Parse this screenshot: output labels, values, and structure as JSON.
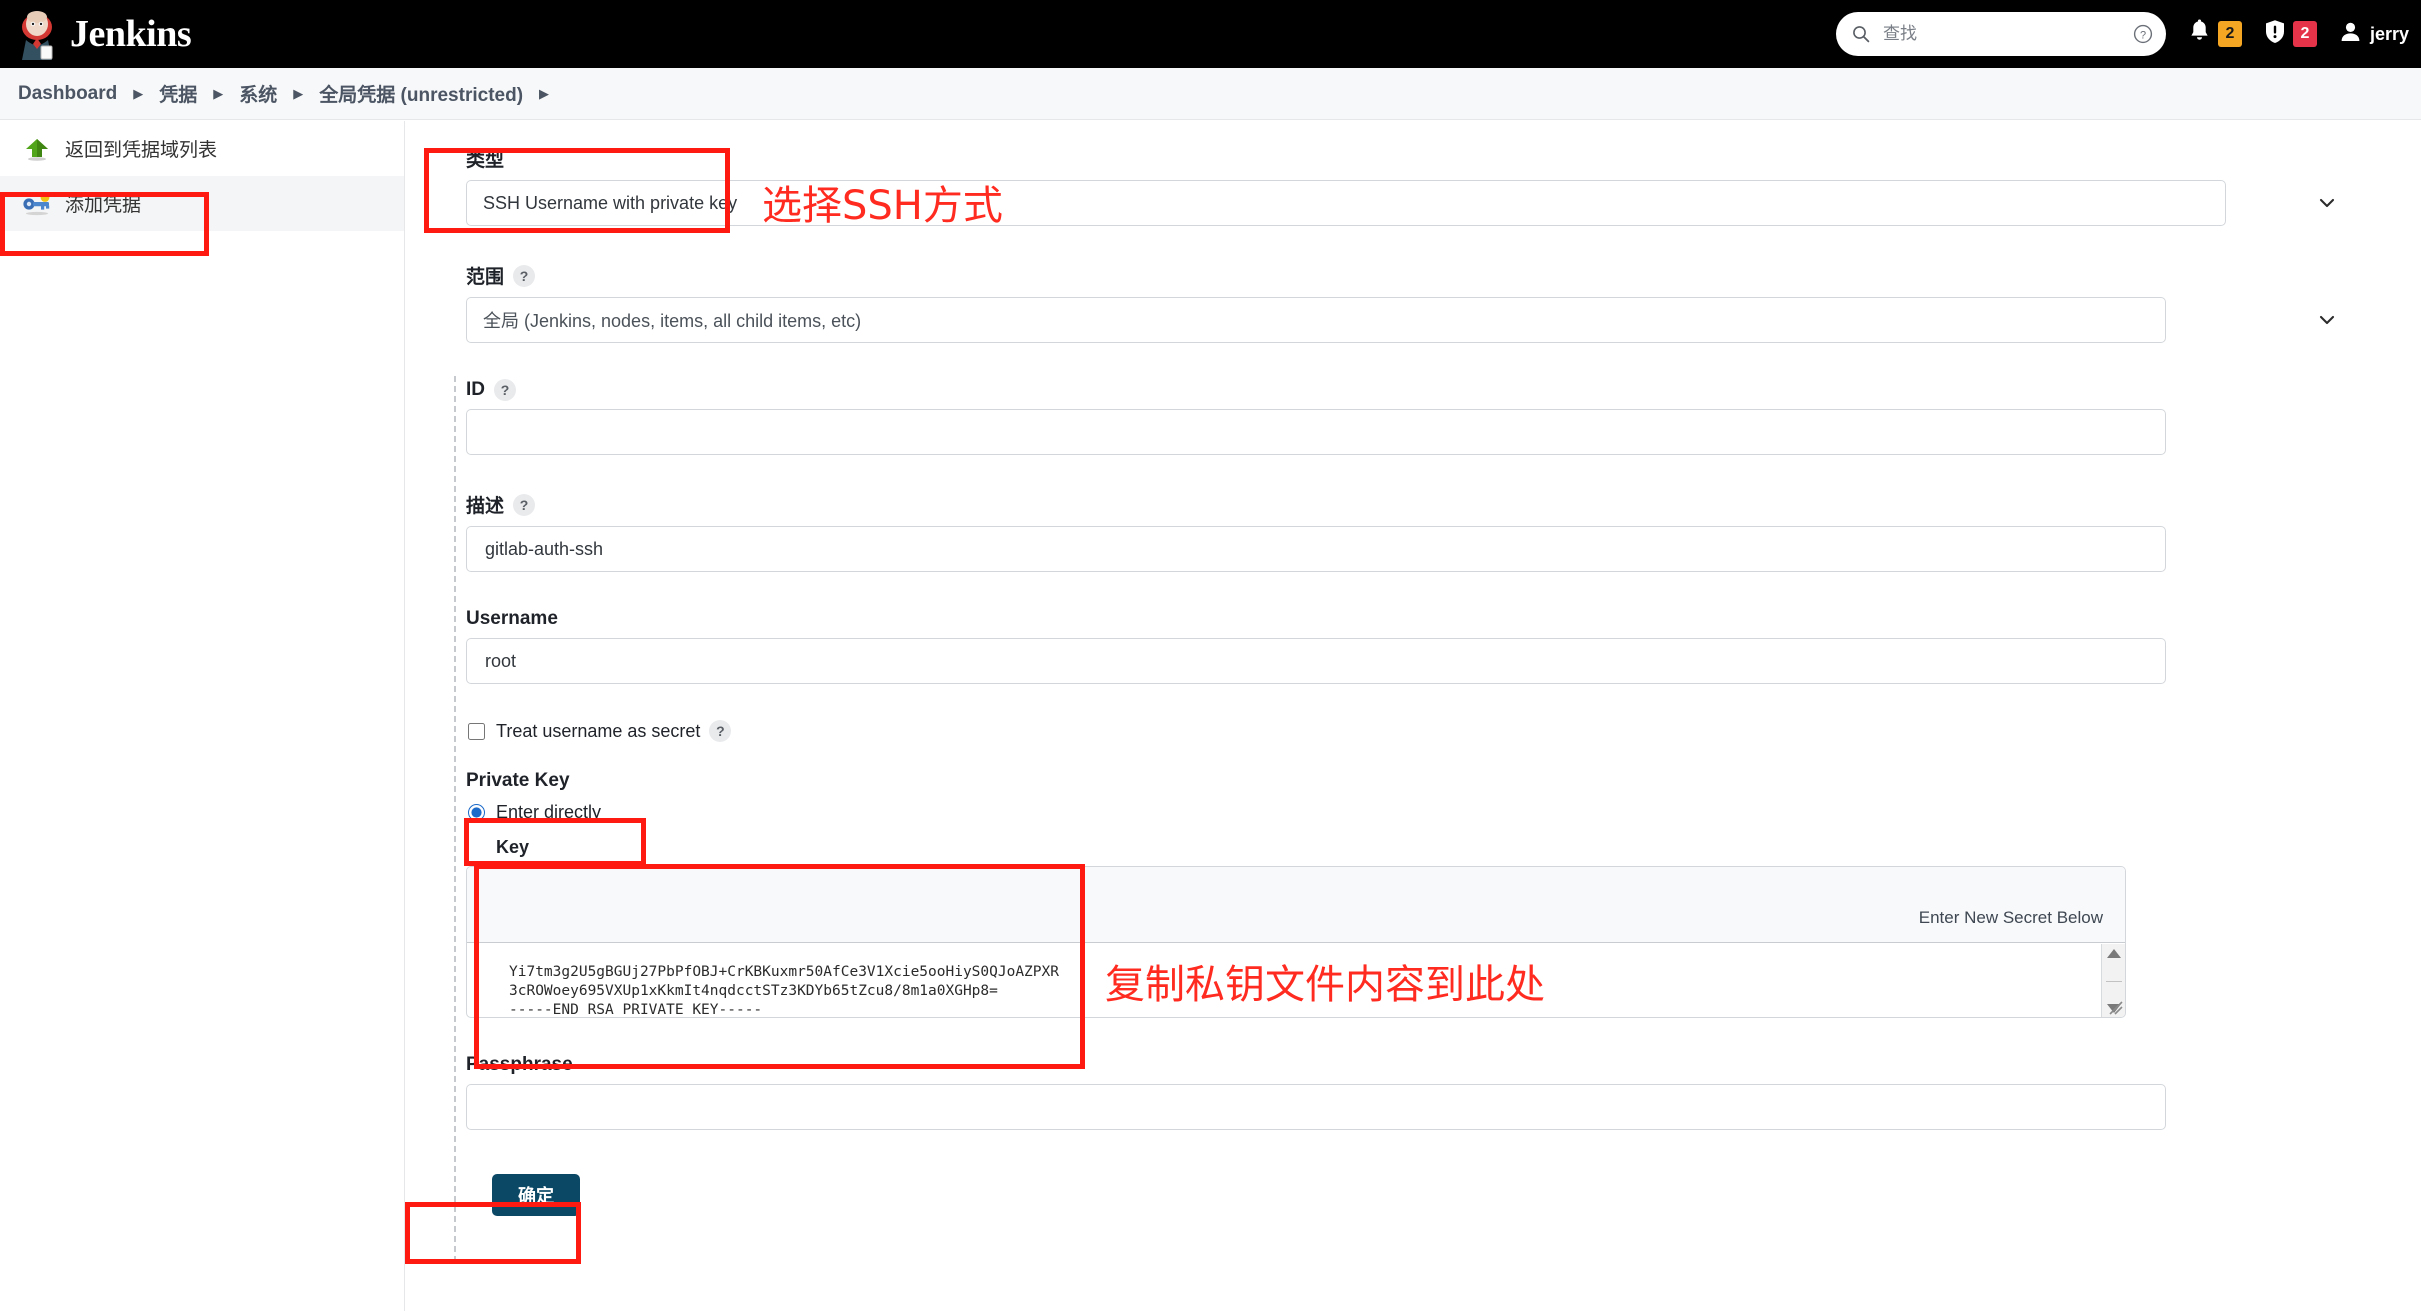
{
  "header": {
    "brand": "Jenkins",
    "search": {
      "placeholder": "查找",
      "value": ""
    },
    "icons": {
      "search": "search-icon",
      "help": "help-circle-icon",
      "bell": "bell-icon",
      "security": "security-shield-icon",
      "user": "user-avatar-icon"
    },
    "notification_count": "2",
    "security_count": "2",
    "user": "jerry"
  },
  "breadcrumb": [
    {
      "label": "Dashboard"
    },
    {
      "label": "凭据"
    },
    {
      "label": "系统"
    },
    {
      "label": "全局凭据 (unrestricted)"
    }
  ],
  "sidebar": {
    "items": [
      {
        "label": "返回到凭据域列表",
        "icon": "up-arrow-icon",
        "active": false
      },
      {
        "label": "添加凭据",
        "icon": "key-icon",
        "active": true
      }
    ]
  },
  "form": {
    "type": {
      "label": "类型",
      "value": "SSH Username with private key"
    },
    "scope": {
      "label": "范围",
      "help": "?",
      "value": "全局 (Jenkins, nodes, items, all child items, etc)"
    },
    "id": {
      "label": "ID",
      "help": "?",
      "value": ""
    },
    "description": {
      "label": "描述",
      "help": "?",
      "value": "gitlab-auth-ssh"
    },
    "username": {
      "label": "Username",
      "value": "root"
    },
    "treat_username_as_secret": {
      "label": "Treat username as secret",
      "help": "?",
      "checked": false
    },
    "private_key": {
      "label": "Private Key",
      "option_label": "Enter directly",
      "selected": true,
      "key_label": "Key",
      "secret_hint": "Enter New Secret Below",
      "key_value": "Yi7tm3g2U5gBGUj27PbPfOBJ+CrKBKuxmr50AfCe3V1Xcie5ooHiyS0QJoAZPXR\n3cROWoey695VXUp1xKkmIt4nqdcctSTz3KDYb65tZcu8/8m1a0XGHp8=\n-----END RSA PRIVATE KEY-----"
    },
    "passphrase": {
      "label": "Passphrase",
      "value": ""
    },
    "submit": {
      "label": "确定"
    }
  },
  "annotations": [
    {
      "text": "选择SSH方式"
    },
    {
      "text": "复制私钥文件内容到此处"
    }
  ],
  "colors": {
    "header_bg": "#000000",
    "annotation_red": "#ff1a11",
    "primary_button": "#0b4865",
    "badge_orange": "#f5a623",
    "badge_red": "#e5344a"
  }
}
